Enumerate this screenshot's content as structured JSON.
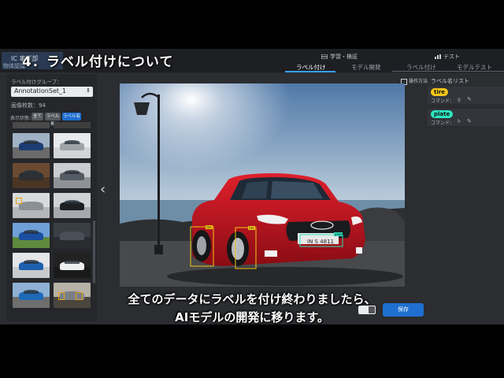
{
  "header": {
    "logo_line1": "IC 事業部",
    "logo_line2": "物体認識",
    "section_title": "4．ラベル付けについて",
    "groups": [
      {
        "label": "学習・検証",
        "icon": "training-icon"
      },
      {
        "label": "テスト",
        "icon": "chart-icon"
      }
    ],
    "tabs": [
      "ラベル付け",
      "モデル開発",
      "ラベル付け",
      "モデルテスト"
    ],
    "accent": "#3aa0ff"
  },
  "left_panel": {
    "group_label": "ラベル付けグループ：",
    "selected_group": "AnnotationSet_1",
    "image_count": "画像枚数：94",
    "filter_label": "表示状態：",
    "filter_chips": [
      "全て",
      "ラベル無",
      "ラベル有"
    ]
  },
  "operations_label": "操作方法",
  "label_list": {
    "title": "ラベル名リスト",
    "items": [
      {
        "name": "tire",
        "command_label": "コマンド：",
        "key": "g",
        "color": "#f5c518"
      },
      {
        "name": "plate",
        "command_label": "コマンド：",
        "key": "h",
        "color": "#2ee6c0"
      }
    ]
  },
  "annotations": {
    "tire": "tire",
    "plate": "plate",
    "license_text": "IN S 4811"
  },
  "save_label": "保存",
  "subtitles": [
    "全てのデータにラベルを付け終わりましたら、",
    "AIモデルの開発に移ります。"
  ]
}
